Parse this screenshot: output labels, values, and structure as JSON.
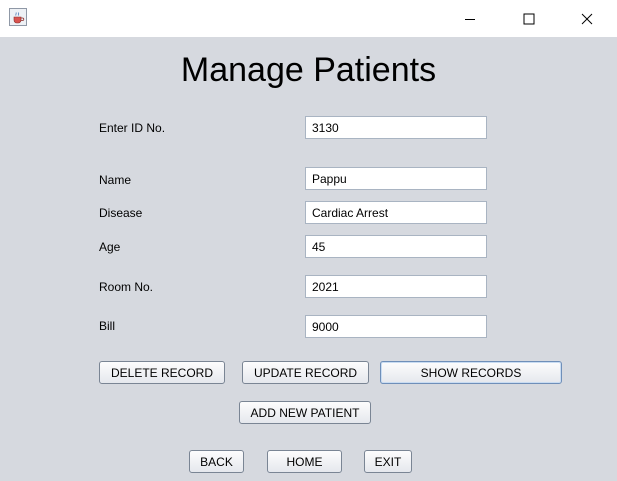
{
  "window": {
    "icon": "java-cup-icon",
    "controls": {
      "minimize": "minimize-icon",
      "maximize": "maximize-icon",
      "close": "close-icon"
    }
  },
  "page": {
    "title": "Manage Patients"
  },
  "form": {
    "id_label": "Enter ID No.",
    "id_value": "3130",
    "name_label": "Name",
    "name_value": "Pappu",
    "disease_label": "Disease",
    "disease_value": "Cardiac Arrest",
    "age_label": "Age",
    "age_value": "45",
    "room_label": "Room No.",
    "room_value": "2021",
    "bill_label": "Bill",
    "bill_value": "9000"
  },
  "buttons": {
    "delete": "DELETE RECORD",
    "update": "UPDATE RECORD",
    "show": "SHOW RECORDS",
    "add": "ADD NEW PATIENT",
    "back": "BACK",
    "home": "HOME",
    "exit": "EXIT"
  },
  "colors": {
    "background": "#d6d9df",
    "titlebar": "#ffffff",
    "field_border": "#a9b4c2",
    "button_border": "#7a8594",
    "focus_border": "#6f8fb9"
  }
}
